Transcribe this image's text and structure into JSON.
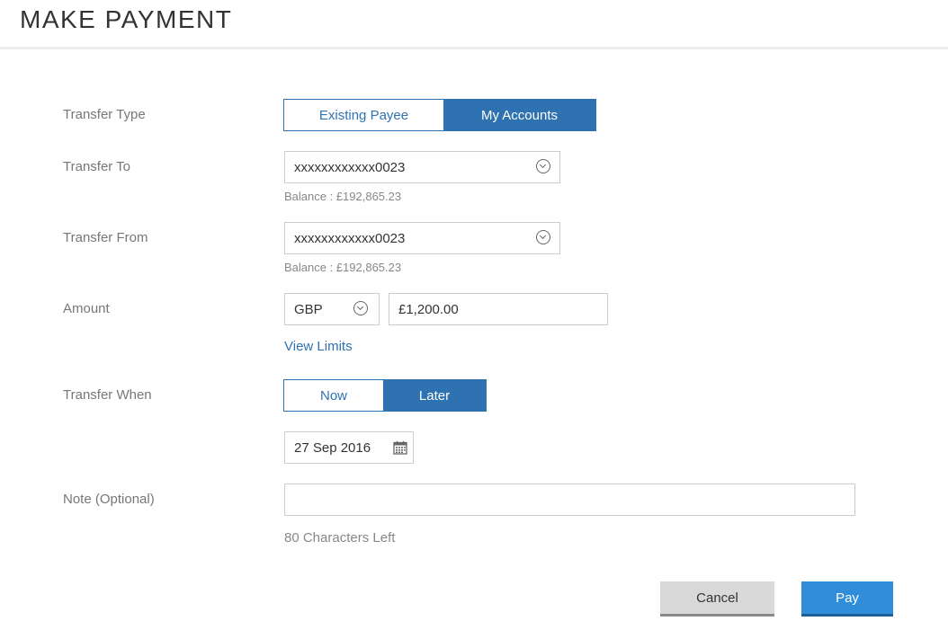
{
  "header": {
    "title": "MAKE PAYMENT"
  },
  "form": {
    "transfer_type": {
      "label": "Transfer Type",
      "options": [
        "Existing Payee",
        "My Accounts"
      ],
      "selected": "My Accounts"
    },
    "transfer_to": {
      "label": "Transfer To",
      "value": "xxxxxxxxxxxx0023",
      "balance": "Balance : £192,865.23"
    },
    "transfer_from": {
      "label": "Transfer From",
      "value": "xxxxxxxxxxxx0023",
      "balance": "Balance : £192,865.23"
    },
    "amount": {
      "label": "Amount",
      "currency": "GBP",
      "value": "£1,200.00",
      "view_limits": "View Limits"
    },
    "transfer_when": {
      "label": "Transfer When",
      "options": [
        "Now",
        "Later"
      ],
      "selected": "Later",
      "date": "27 Sep 2016"
    },
    "note": {
      "label": "Note (Optional)",
      "value": "",
      "chars_left": "80 Characters Left"
    }
  },
  "actions": {
    "cancel": "Cancel",
    "pay": "Pay"
  },
  "colors": {
    "accent": "#2f72b1",
    "pay_button": "#2f8dd9",
    "cancel_button": "#d9d9d9"
  },
  "icons": {
    "dropdown": "chevron-down-circle-icon",
    "calendar": "calendar-icon"
  }
}
